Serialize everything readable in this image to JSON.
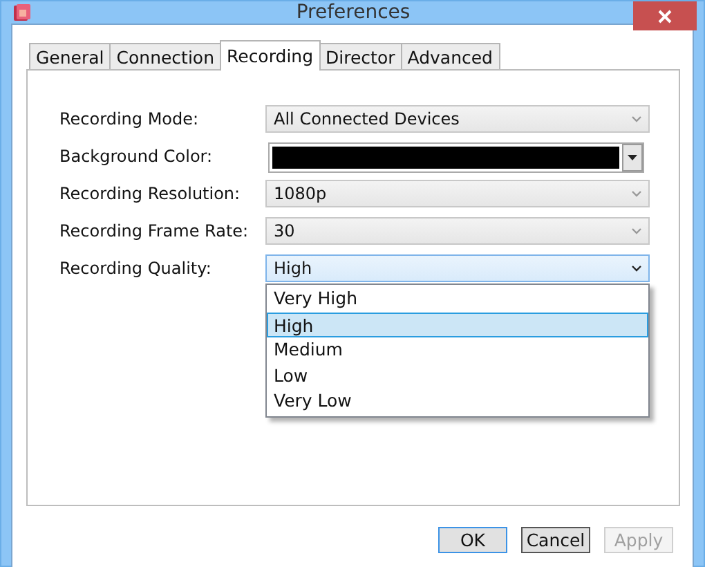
{
  "window": {
    "title": "Preferences"
  },
  "tabs": [
    {
      "label": "General",
      "selected": false
    },
    {
      "label": "Connection",
      "selected": false
    },
    {
      "label": "Recording",
      "selected": true
    },
    {
      "label": "Director",
      "selected": false
    },
    {
      "label": "Advanced",
      "selected": false
    }
  ],
  "fields": [
    {
      "kind": "select",
      "label": "Recording Mode:",
      "value": "All Connected Devices",
      "expanded": false
    },
    {
      "kind": "color",
      "label": "Background Color:",
      "color": "#000000"
    },
    {
      "kind": "select",
      "label": "Recording Resolution:",
      "value": "1080p",
      "expanded": false
    },
    {
      "kind": "select",
      "label": "Recording Frame Rate:",
      "value": "30",
      "expanded": false
    },
    {
      "kind": "select",
      "label": "Recording Quality:",
      "value": "High",
      "expanded": true,
      "options": [
        {
          "label": "Very High",
          "selected": false
        },
        {
          "label": "High",
          "selected": true
        },
        {
          "label": "Medium",
          "selected": false
        },
        {
          "label": "Low",
          "selected": false
        },
        {
          "label": "Very Low",
          "selected": false
        }
      ]
    }
  ],
  "buttons": [
    {
      "label": "OK",
      "default": true,
      "focused": false,
      "disabled": false
    },
    {
      "label": "Cancel",
      "default": false,
      "focused": true,
      "disabled": false
    },
    {
      "label": "Apply",
      "default": false,
      "focused": false,
      "disabled": true
    }
  ]
}
